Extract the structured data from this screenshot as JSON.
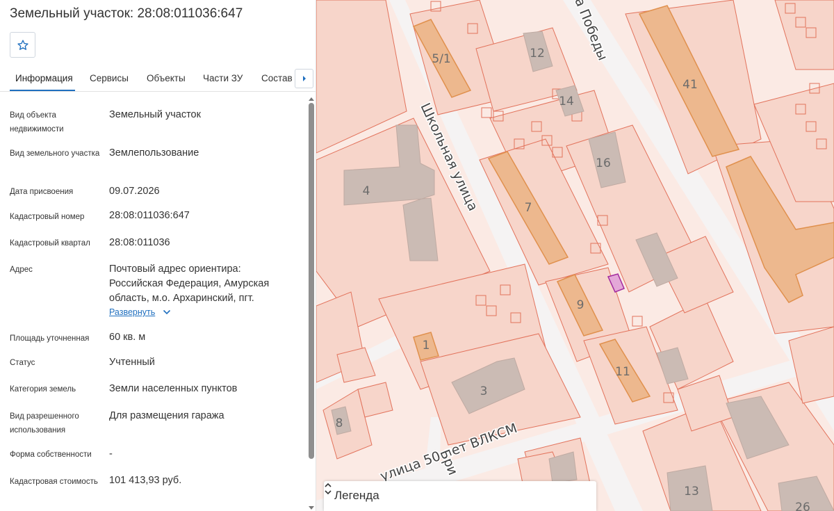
{
  "panel": {
    "title": "Земельный участок: 28:08:011036:647",
    "tabs": [
      {
        "label": "Информация"
      },
      {
        "label": "Сервисы"
      },
      {
        "label": "Объекты"
      },
      {
        "label": "Части ЗУ"
      },
      {
        "label": "Состав"
      }
    ],
    "rows": [
      {
        "label": "Вид объекта недвижимости",
        "value": "Земельный участок"
      },
      {
        "label": "Вид земельного участка",
        "value": "Землепользование"
      },
      {
        "label": "Дата присвоения",
        "value": "09.07.2026"
      },
      {
        "label": "Кадастровый номер",
        "value": "28:08:011036:647"
      },
      {
        "label": "Кадастровый квартал",
        "value": "28:08:011036"
      },
      {
        "label": "Адрес",
        "value": "Почтовый адрес ориентира: Российская Федерация, Амурская область, м.о. Архаринский, пгт."
      },
      {
        "label": "Площадь уточненная",
        "value": "60 кв. м"
      },
      {
        "label": "Статус",
        "value": "Учтенный"
      },
      {
        "label": "Категория земель",
        "value": "Земли населенных пунктов"
      },
      {
        "label": "Вид разрешенного использования",
        "value": "Для размещения гаража"
      },
      {
        "label": "Форма собственности",
        "value": "-"
      },
      {
        "label": "Кадастровая стоимость",
        "value": "101 413,93 руб."
      }
    ],
    "expand_link": "Развернуть"
  },
  "map": {
    "streets": [
      {
        "name": "Школьная улица"
      },
      {
        "name": "улица 50 лет ВЛКСМ"
      },
      {
        "name": "а Победы"
      },
      {
        "name": "Бри"
      }
    ],
    "building_numbers": [
      "5/1",
      "12",
      "41",
      "14",
      "16",
      "4",
      "7",
      "9",
      "1",
      "11",
      "3",
      "8",
      "13",
      "26"
    ],
    "legend_label": "Легенда",
    "colors": {
      "parcel_fill": "#f7d5ca",
      "parcel_stroke": "#e2725b",
      "building_fill": "#edb88e",
      "building_stroke": "#e0904d",
      "gray_building": "#cbbbb4",
      "selected_fill": "#e4a8d8",
      "selected_stroke": "#a22a9f",
      "road": "#f5f3f3"
    }
  }
}
